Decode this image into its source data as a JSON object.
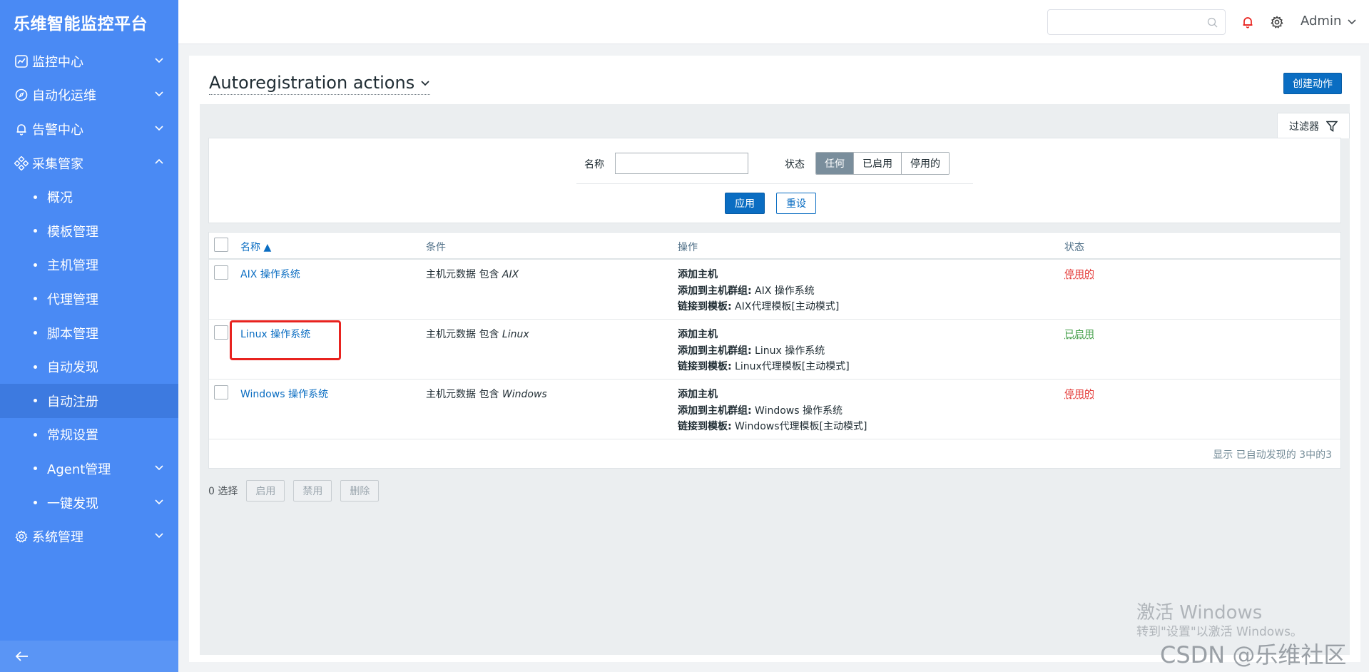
{
  "sidebar": {
    "brand": "乐维智能监控平台",
    "items": [
      {
        "label": "监控中心",
        "icon": "chart-line-icon",
        "expand": "collapsed"
      },
      {
        "label": "自动化运维",
        "icon": "compass-icon",
        "expand": "collapsed"
      },
      {
        "label": "告警中心",
        "icon": "bell-icon",
        "expand": "collapsed"
      },
      {
        "label": "采集管家",
        "icon": "nodes-icon",
        "expand": "expanded"
      }
    ],
    "sub_items": [
      {
        "label": "概况"
      },
      {
        "label": "模板管理"
      },
      {
        "label": "主机管理"
      },
      {
        "label": "代理管理"
      },
      {
        "label": "脚本管理"
      },
      {
        "label": "自动发现"
      },
      {
        "label": "自动注册",
        "active": true
      },
      {
        "label": "常规设置"
      },
      {
        "label": "Agent管理",
        "expand": "collapsed"
      },
      {
        "label": "一键发现",
        "expand": "collapsed"
      }
    ],
    "bottom_item": {
      "label": "系统管理",
      "icon": "gear-icon",
      "expand": "collapsed"
    },
    "collapse_icon": "arrow-left-icon"
  },
  "topbar": {
    "search_placeholder": "",
    "user": "Admin"
  },
  "page": {
    "title": "Autoregistration actions",
    "create_button": "创建动作"
  },
  "filter": {
    "tab_label": "过滤器",
    "name_label": "名称",
    "name_value": "",
    "status_label": "状态",
    "status_options": [
      "任何",
      "已启用",
      "停用的"
    ],
    "status_selected": "任何",
    "apply": "应用",
    "reset": "重设"
  },
  "table": {
    "headers": {
      "name": "名称 ▲",
      "conditions": "条件",
      "operations": "操作",
      "status": "状态"
    },
    "rows": [
      {
        "name": "AIX 操作系统",
        "cond_prefix": "主机元数据 包含 ",
        "cond_value": "AIX",
        "op1": "添加主机",
        "op2_label": "添加到主机群组:",
        "op2_value": " AIX 操作系统",
        "op3_label": "链接到模板:",
        "op3_value": " AIX代理模板[主动模式]",
        "status": "停用的"
      },
      {
        "name": "Linux 操作系统",
        "cond_prefix": "主机元数据 包含 ",
        "cond_value": "Linux",
        "op1": "添加主机",
        "op2_label": "添加到主机群组:",
        "op2_value": " Linux 操作系统",
        "op3_label": "链接到模板:",
        "op3_value": " Linux代理模板[主动模式]",
        "status": "已启用"
      },
      {
        "name": "Windows 操作系统",
        "cond_prefix": "主机元数据 包含 ",
        "cond_value": "Windows",
        "op1": "添加主机",
        "op2_label": "添加到主机群组:",
        "op2_value": " Windows 操作系统",
        "op3_label": "链接到模板:",
        "op3_value": " Windows代理模板[主动模式]",
        "status": "停用的"
      }
    ],
    "footer": "显示 已自动发现的 3中的3"
  },
  "mass_actions": {
    "selected": "0 选择",
    "enable": "启用",
    "disable": "禁用",
    "delete": "删除"
  },
  "watermark": {
    "line1": "激活 Windows",
    "line2": "转到\"设置\"以激活 Windows。",
    "csdn": "CSDN @乐维社区"
  },
  "colors": {
    "sidebar": "#4a8af4",
    "primary": "#0a6dc2",
    "disabled_status": "#e33734",
    "enabled_status": "#429e47",
    "highlight_box": "#e8231f"
  }
}
